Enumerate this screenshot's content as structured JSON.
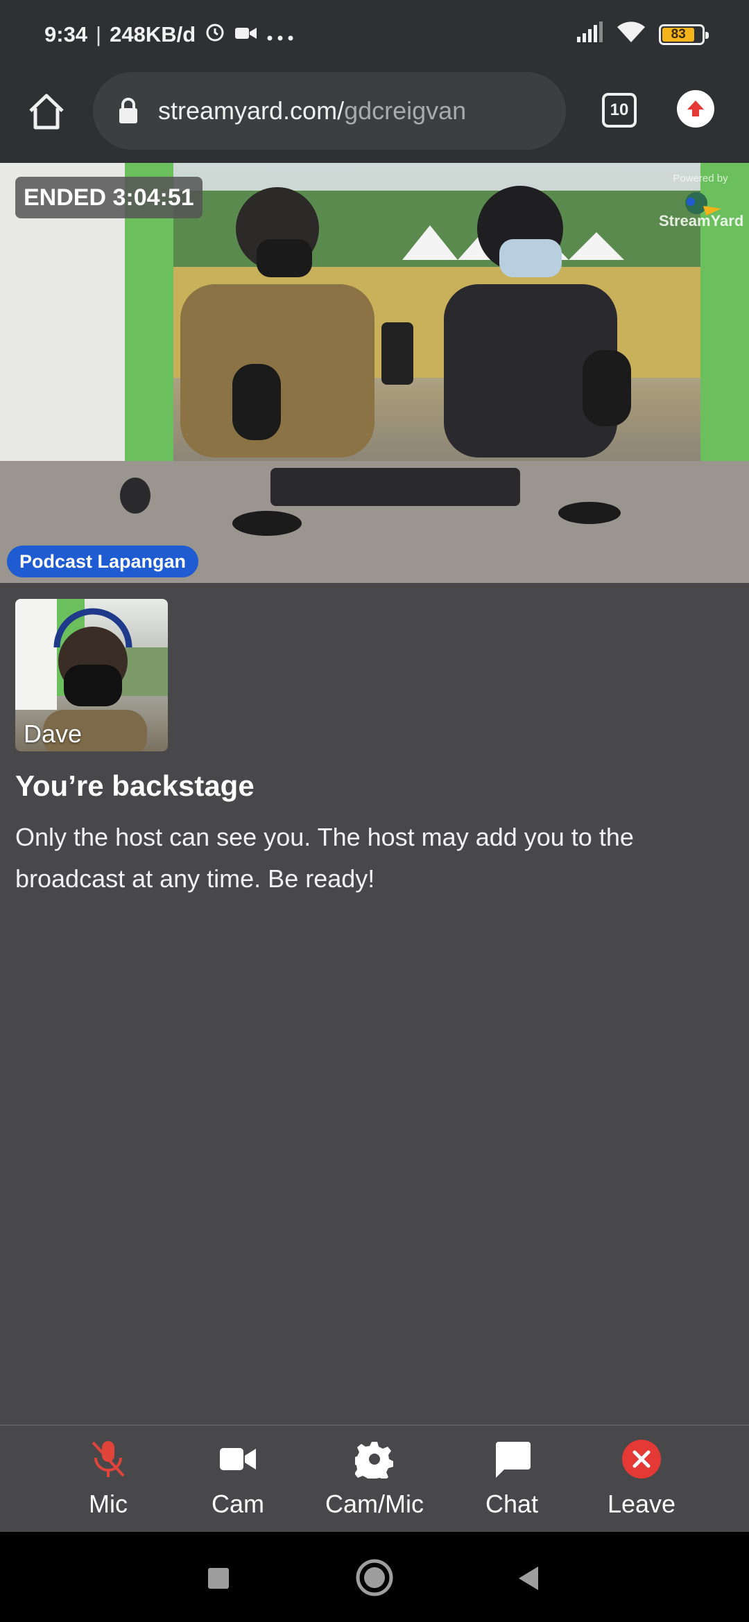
{
  "status_bar": {
    "time": "9:34",
    "data_rate": "248KB/d",
    "battery_percent": "83",
    "icons": [
      "alarm-icon",
      "video-call-icon",
      "more-dots-icon",
      "signal-icon",
      "wifi-icon",
      "battery-icon"
    ]
  },
  "browser": {
    "url_host": "streamyard.com/",
    "url_path": "gdcreigvan",
    "tab_count": "10",
    "icons": [
      "home-icon",
      "lock-icon",
      "tabs-icon",
      "update-icon"
    ]
  },
  "stream": {
    "ended_label": "ENDED 3:04:51",
    "powered_by": "Powered by",
    "brand": "StreamYard",
    "name_badge": "Podcast Lapangan"
  },
  "participant": {
    "name": "Dave"
  },
  "backstage": {
    "title": "You’re backstage",
    "message": "Only the host can see you. The host may add you to the broadcast at any time. Be ready!"
  },
  "controls": {
    "mic": "Mic",
    "cam": "Cam",
    "cam_mic": "Cam/Mic",
    "chat": "Chat",
    "leave": "Leave"
  },
  "colors": {
    "background": "#48484b",
    "bar": "#2f3033",
    "badge_blue": "#1f5bd1",
    "muted_red": "#e0443a",
    "leave_red": "#e53935"
  }
}
